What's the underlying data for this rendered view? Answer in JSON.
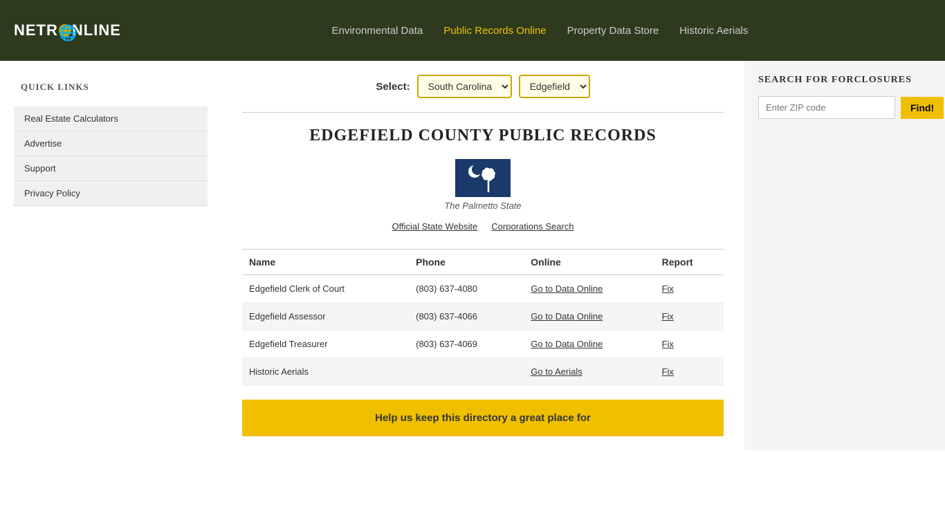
{
  "header": {
    "logo_text": "NETR",
    "logo_suffix": "NLINE",
    "nav": [
      {
        "label": "Environmental Data",
        "active": false,
        "id": "env-data"
      },
      {
        "label": "Public Records Online",
        "active": true,
        "id": "pub-records"
      },
      {
        "label": "Property Data Store",
        "active": false,
        "id": "prop-data"
      },
      {
        "label": "Historic Aerials",
        "active": false,
        "id": "hist-aerials"
      }
    ]
  },
  "sidebar": {
    "title": "Quick Links",
    "items": [
      {
        "label": "Real Estate Calculators",
        "id": "real-estate"
      },
      {
        "label": "Advertise",
        "id": "advertise"
      },
      {
        "label": "Support",
        "id": "support"
      },
      {
        "label": "Privacy Policy",
        "id": "privacy"
      }
    ]
  },
  "select": {
    "label": "Select:",
    "state_selected": "South Carolina",
    "county_selected": "Edgefield",
    "states": [
      "South Carolina"
    ],
    "counties": [
      "Edgefield"
    ]
  },
  "county": {
    "title": "Edgefield County Public Records",
    "flag_caption": "The Palmetto State",
    "state_link1": "Official State Website",
    "state_link2": "Corporations Search",
    "table": {
      "columns": [
        "Name",
        "Phone",
        "Online",
        "Report"
      ],
      "rows": [
        {
          "name": "Edgefield Clerk of Court",
          "phone": "(803) 637-4080",
          "online_label": "Go to Data Online",
          "report_label": "Fix"
        },
        {
          "name": "Edgefield Assessor",
          "phone": "(803) 637-4066",
          "online_label": "Go to Data Online",
          "report_label": "Fix"
        },
        {
          "name": "Edgefield Treasurer",
          "phone": "(803) 637-4069",
          "online_label": "Go to Data Online",
          "report_label": "Fix"
        },
        {
          "name": "Historic Aerials",
          "phone": "",
          "online_label": "Go to Aerials",
          "report_label": "Fix"
        }
      ]
    }
  },
  "foreclosure": {
    "title": "Search for Forclosures",
    "placeholder": "Enter ZIP code",
    "button_label": "Find!"
  },
  "bottom_banner": {
    "text": "Help us keep this directory a great place for"
  }
}
